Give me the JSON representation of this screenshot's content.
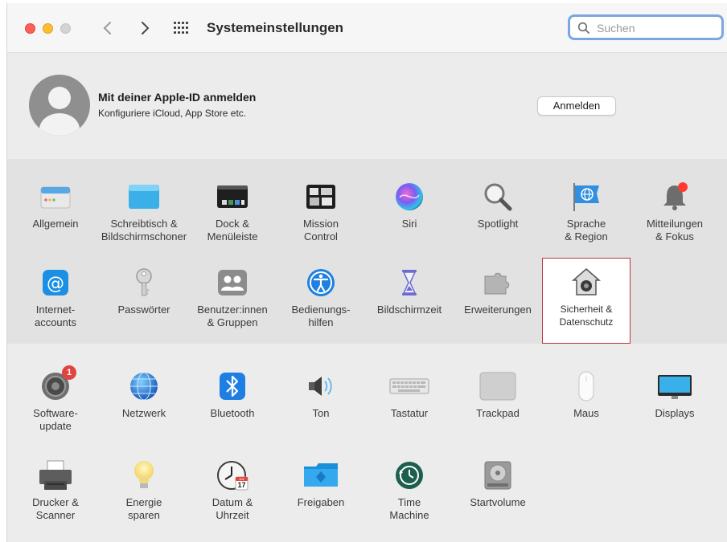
{
  "window": {
    "title": "Systemeinstellungen",
    "search_placeholder": "Suchen"
  },
  "apple_id": {
    "title": "Mit deiner Apple-ID anmelden",
    "subtitle": "Konfiguriere iCloud, App Store etc.",
    "signin_label": "Anmelden"
  },
  "section1": [
    {
      "label": "Allgemein",
      "icon": "general-icon"
    },
    {
      "label": "Schreibtisch &\nBildschirmschoner",
      "icon": "desktop-icon"
    },
    {
      "label": "Dock &\nMenüleiste",
      "icon": "dock-icon"
    },
    {
      "label": "Mission\nControl",
      "icon": "mission-control-icon"
    },
    {
      "label": "Siri",
      "icon": "siri-icon"
    },
    {
      "label": "Spotlight",
      "icon": "spotlight-icon"
    },
    {
      "label": "Sprache\n& Region",
      "icon": "language-region-icon"
    },
    {
      "label": "Mitteilungen\n& Fokus",
      "icon": "notifications-icon"
    },
    {
      "label": "Internet-\naccounts",
      "icon": "internet-accounts-icon"
    },
    {
      "label": "Passwörter",
      "icon": "key-icon"
    },
    {
      "label": "Benutzer:innen\n& Gruppen",
      "icon": "users-icon"
    },
    {
      "label": "Bedienungs-\nhilfen",
      "icon": "accessibility-icon"
    },
    {
      "label": "Bildschirmzeit",
      "icon": "hourglass-icon"
    },
    {
      "label": "Erweiterungen",
      "icon": "puzzle-icon"
    },
    {
      "label": "Sicherheit &\nDatenschutz",
      "icon": "security-house-icon",
      "selected": true
    }
  ],
  "section2": [
    {
      "label": "Software-\nupdate",
      "icon": "software-update-icon",
      "badge": "1"
    },
    {
      "label": "Netzwerk",
      "icon": "network-globe-icon"
    },
    {
      "label": "Bluetooth",
      "icon": "bluetooth-icon"
    },
    {
      "label": "Ton",
      "icon": "speaker-icon"
    },
    {
      "label": "Tastatur",
      "icon": "keyboard-icon"
    },
    {
      "label": "Trackpad",
      "icon": "trackpad-icon"
    },
    {
      "label": "Maus",
      "icon": "mouse-icon"
    },
    {
      "label": "Displays",
      "icon": "display-icon"
    },
    {
      "label": "Drucker &\nScanner",
      "icon": "printer-icon"
    },
    {
      "label": "Energie\nsparen",
      "icon": "lightbulb-icon"
    },
    {
      "label": "Datum &\nUhrzeit",
      "icon": "clock-icon",
      "calendar_month": "JUL",
      "calendar_day": "17"
    },
    {
      "label": "Freigaben",
      "icon": "sharing-folder-icon"
    },
    {
      "label": "Time\nMachine",
      "icon": "time-machine-icon"
    },
    {
      "label": "Startvolume",
      "icon": "startup-disk-icon"
    }
  ]
}
